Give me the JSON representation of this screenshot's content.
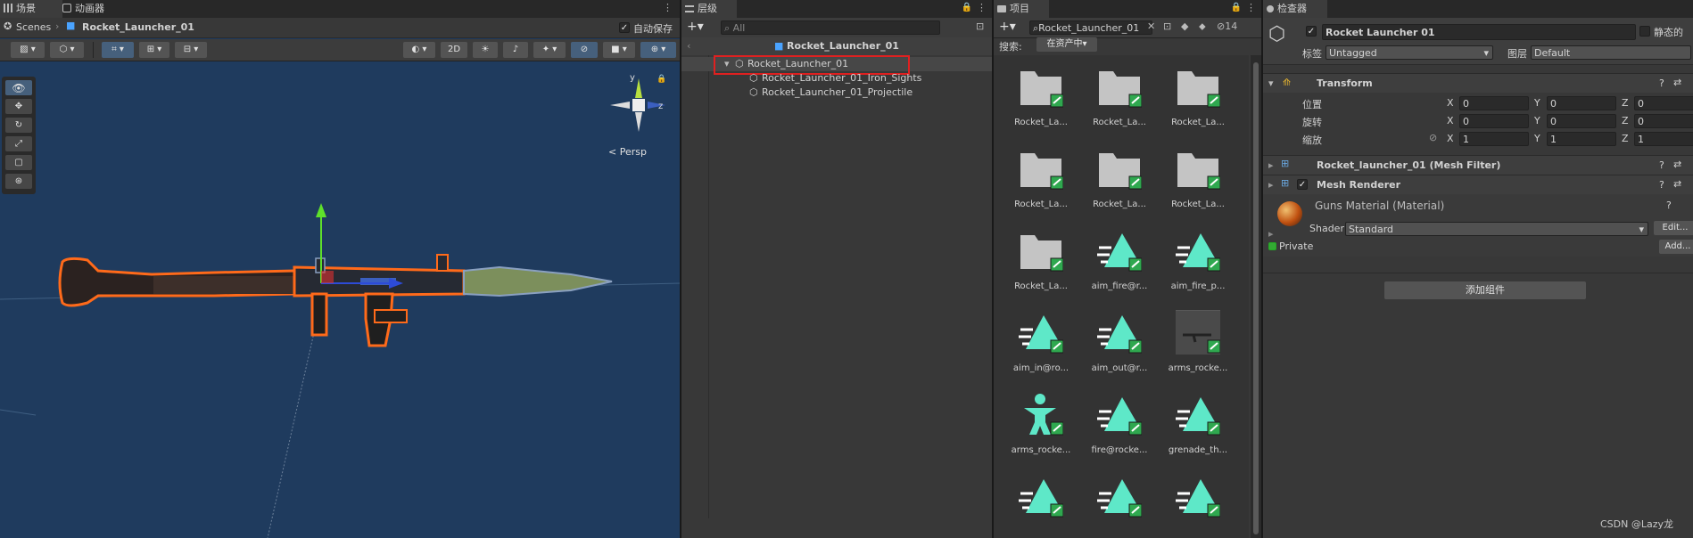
{
  "scene_panel": {
    "tabs": [
      "场景",
      "动画器"
    ],
    "breadcrumb_root": "Scenes",
    "breadcrumb_object": "Rocket_Launcher_01",
    "autosave_label": "自动保存",
    "btn_2d": "2D",
    "persp_label": "Persp",
    "gizmo_y": "y",
    "gizmo_z": "z"
  },
  "hierarchy": {
    "tab": "层级",
    "search_placeholder": "All",
    "scene_title": "Rocket_Launcher_01",
    "items": [
      {
        "label": "Rocket_Launcher_01",
        "selected": true,
        "highlight_box": true
      },
      {
        "label": "Rocket_Launcher_01_Iron_Sights"
      },
      {
        "label": "Rocket_Launcher_01_Projectile"
      }
    ]
  },
  "project": {
    "tab": "项目",
    "search_value": "Rocket_Launcher_01",
    "hidden_count": "14",
    "search_label": "搜索:",
    "search_scope": "在资产中",
    "assets": [
      {
        "label": "Rocket_La...",
        "icon": "folder-icon"
      },
      {
        "label": "Rocket_La...",
        "icon": "folder-icon"
      },
      {
        "label": "Rocket_La...",
        "icon": "folder-icon"
      },
      {
        "label": "Rocket_La...",
        "icon": "folder-icon"
      },
      {
        "label": "Rocket_La...",
        "icon": "folder-icon"
      },
      {
        "label": "Rocket_La...",
        "icon": "folder-icon"
      },
      {
        "label": "Rocket_La...",
        "icon": "folder-icon"
      },
      {
        "label": "aim_fire@r...",
        "icon": "animation-clip-icon"
      },
      {
        "label": "aim_fire_p...",
        "icon": "animation-clip-icon"
      },
      {
        "label": "aim_in@ro...",
        "icon": "animation-clip-icon"
      },
      {
        "label": "aim_out@r...",
        "icon": "animation-clip-icon"
      },
      {
        "label": "arms_rocke...",
        "icon": "model-preview-icon"
      },
      {
        "label": "arms_rocke...",
        "icon": "avatar-icon"
      },
      {
        "label": "fire@rocke...",
        "icon": "animation-clip-icon"
      },
      {
        "label": "grenade_th...",
        "icon": "animation-clip-icon"
      },
      {
        "label": "",
        "icon": "animation-clip-icon"
      },
      {
        "label": "",
        "icon": "animation-clip-icon"
      },
      {
        "label": "",
        "icon": "animation-clip-icon"
      }
    ]
  },
  "inspector": {
    "tab": "检查器",
    "object_name": "Rocket Launcher 01",
    "static_label": "静态的",
    "tag_label": "标签",
    "tag_value": "Untagged",
    "layer_label": "图层",
    "layer_value": "Default",
    "transform": {
      "title": "Transform",
      "rows": [
        {
          "label": "位置",
          "x": "0",
          "y": "0",
          "z": "0"
        },
        {
          "label": "旋转",
          "x": "0",
          "y": "0",
          "z": "0"
        },
        {
          "label": "缩放",
          "x": "1",
          "y": "1",
          "z": "1"
        }
      ],
      "axis_x": "X",
      "axis_y": "Y",
      "axis_z": "Z"
    },
    "mesh_filter": "Rocket_launcher_01 (Mesh Filter)",
    "mesh_renderer": "Mesh Renderer",
    "material_name": "Guns Material (Material)",
    "shader_label": "Shader",
    "shader_value": "Standard",
    "edit_label": "Edit...",
    "private_label": "Private",
    "add_label": "Add...",
    "add_component": "添加组件"
  },
  "watermark": "CSDN @Lazy龙",
  "colors": {
    "accent_blue": "#2c5d87",
    "selection_red": "#e02020",
    "outline_orange": "#ff6a1a",
    "anim_teal": "#5ee8c8"
  }
}
